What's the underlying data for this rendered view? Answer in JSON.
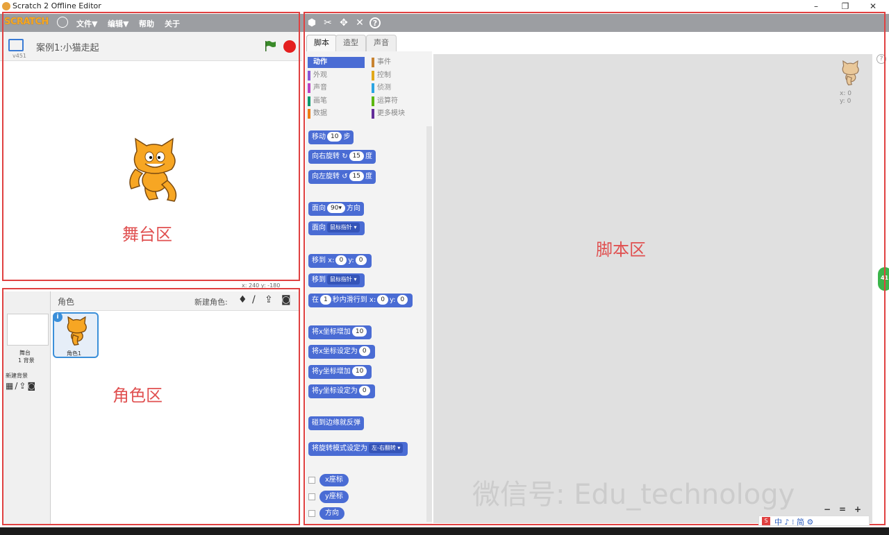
{
  "window": {
    "title": "Scratch 2 Offline Editor",
    "minimize": "–",
    "restore": "❐",
    "close": "✕"
  },
  "menubar": {
    "logo": "SCRATCH",
    "items": [
      "文件▼",
      "编辑▼",
      "帮助",
      "关于"
    ]
  },
  "toolbar": {
    "tools": [
      "duplicate-tool",
      "delete-tool",
      "grow-tool",
      "shrink-tool",
      "help-tool"
    ],
    "help_glyph": "?"
  },
  "stage": {
    "title": "案例1:小猫走起",
    "version": "v451",
    "coords": "x: 240  y: -180",
    "label": "舞台区"
  },
  "sprites": {
    "header_label": "角色",
    "new_sprite_label": "新建角色:",
    "stage_name": "舞台",
    "stage_backdrops": "1 背景",
    "new_backdrop_label": "新建背景",
    "sprite_name": "角色1",
    "info_badge": "i",
    "label": "角色区"
  },
  "tabs": [
    {
      "label": "脚本",
      "active": true
    },
    {
      "label": "造型",
      "active": false
    },
    {
      "label": "声音",
      "active": false
    }
  ],
  "categories": [
    {
      "label": "动作",
      "color": "#4a6cd4",
      "active": true
    },
    {
      "label": "事件",
      "color": "#c88330",
      "active": false
    },
    {
      "label": "外观",
      "color": "#8a55d7",
      "active": false
    },
    {
      "label": "控制",
      "color": "#e1a91a",
      "active": false
    },
    {
      "label": "声音",
      "color": "#bb42c3",
      "active": false
    },
    {
      "label": "侦测",
      "color": "#2ca5e2",
      "active": false
    },
    {
      "label": "画笔",
      "color": "#0e9a6c",
      "active": false
    },
    {
      "label": "运算符",
      "color": "#5cb712",
      "active": false
    },
    {
      "label": "数据",
      "color": "#ee7d16",
      "active": false
    },
    {
      "label": "更多模块",
      "color": "#632d99",
      "active": false
    }
  ],
  "blocks": {
    "move": {
      "pre": "移动",
      "value": "10",
      "post": "步"
    },
    "turn_right": {
      "pre": "向右旋转",
      "icon": "↻",
      "value": "15",
      "post": "度"
    },
    "turn_left": {
      "pre": "向左旋转",
      "icon": "↺",
      "value": "15",
      "post": "度"
    },
    "point_dir": {
      "pre": "面向",
      "value": "90▾",
      "post": "方向"
    },
    "point_towards": {
      "pre": "面向",
      "dropdown": "鼠标指针 ▾"
    },
    "goto_xy": {
      "pre": "移到 x:",
      "x": "0",
      "mid": "y:",
      "y": "0"
    },
    "goto": {
      "pre": "移到",
      "dropdown": "鼠标指针 ▾"
    },
    "glide": {
      "pre": "在",
      "secs": "1",
      "mid": "秒内滑行到 x:",
      "x": "0",
      "mid2": "y:",
      "y": "0"
    },
    "change_x": {
      "pre": "将x坐标增加",
      "value": "10"
    },
    "set_x": {
      "pre": "将x坐标设定为",
      "value": "0"
    },
    "change_y": {
      "pre": "将y坐标增加",
      "value": "10"
    },
    "set_y": {
      "pre": "将y坐标设定为",
      "value": "0"
    },
    "bounce": {
      "label": "碰到边缘就反弹"
    },
    "rotation_style": {
      "pre": "将旋转模式设定为",
      "dropdown": "左-右翻转 ▾"
    },
    "reporters": [
      "x座标",
      "y座标",
      "方向"
    ]
  },
  "script_area": {
    "label": "脚本区",
    "sprite_x": "x: 0",
    "sprite_y": "y: 0",
    "watermark": "微信号: Edu_technology",
    "zoom_out": "−",
    "zoom_reset": "=",
    "zoom_in": "+",
    "side_badge": "41"
  },
  "ime": {
    "text": "中 ♪ ⁝ 简 ⚙"
  }
}
